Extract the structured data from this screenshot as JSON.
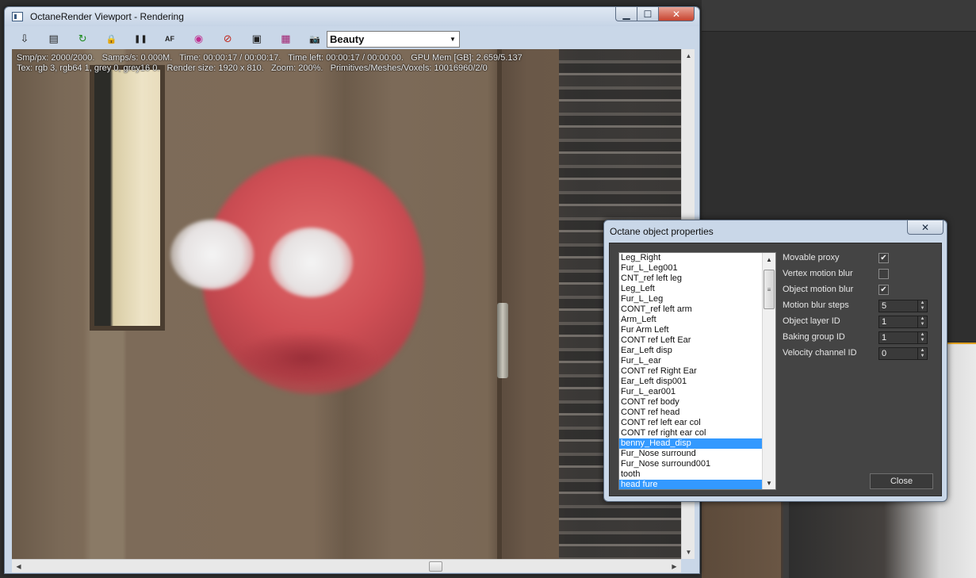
{
  "viewport": {
    "title": "OctaneRender Viewport - Rendering",
    "window_buttons": {
      "minimize": "▁",
      "maximize": "☐",
      "close": "✕"
    },
    "toolbar": {
      "icons": [
        "export-icon",
        "clipboard-icon",
        "refresh-icon",
        "lock-icon",
        "pause-icon",
        "af-icon",
        "color-wheel-icon",
        "region-icon",
        "monitor-icon",
        "film-icon",
        "camera-icon"
      ],
      "icon_glyphs": [
        "⇩",
        "▤",
        "↻",
        "🔒",
        "❚❚",
        "AF",
        "◉",
        "⊘",
        "▣",
        "▦",
        "📷"
      ],
      "render_pass": "Beauty"
    },
    "stats_line1": "Smp/px: 2000/2000.   Samps/s: 0.000M.   Time: 00:00:17 / 00:00:17.   Time left: 00:00:17 / 00:00:00.   GPU Mem [GB]: 2.659/5.137",
    "stats_line2": "Tex: rgb 3, rgb64 1, grey 0, grey16 0.   Render size: 1920 x 810.   Zoom: 200%.   Primitives/Meshes/Voxels: 10016960/2/0"
  },
  "dialog": {
    "title": "Octane object properties",
    "close_x": "✕",
    "objects": [
      {
        "label": "Leg_Right",
        "selected": false
      },
      {
        "label": "Fur_L_Leg001",
        "selected": false
      },
      {
        "label": "CNT_ref left leg",
        "selected": false
      },
      {
        "label": "Leg_Left",
        "selected": false
      },
      {
        "label": "Fur_L_Leg",
        "selected": false
      },
      {
        "label": "CONT_ref left arm",
        "selected": false
      },
      {
        "label": "Arm_Left",
        "selected": false
      },
      {
        "label": "Fur Arm Left",
        "selected": false
      },
      {
        "label": "CONT ref Left Ear",
        "selected": false
      },
      {
        "label": "Ear_Left disp",
        "selected": false
      },
      {
        "label": "Fur_L_ear",
        "selected": false
      },
      {
        "label": "CONT ref Right Ear",
        "selected": false
      },
      {
        "label": "Ear_Left disp001",
        "selected": false
      },
      {
        "label": "Fur_L_ear001",
        "selected": false
      },
      {
        "label": "CONT ref body",
        "selected": false
      },
      {
        "label": "CONT ref head",
        "selected": false
      },
      {
        "label": "CONT ref left ear col",
        "selected": false
      },
      {
        "label": "CONT ref right ear col",
        "selected": false
      },
      {
        "label": "benny_Head_disp",
        "selected": true
      },
      {
        "label": "Fur_Nose surround",
        "selected": false
      },
      {
        "label": "Fur_Nose surround001",
        "selected": false
      },
      {
        "label": "tooth",
        "selected": false
      },
      {
        "label": "head fure",
        "selected": true
      }
    ],
    "properties": {
      "movable_proxy": {
        "label": "Movable proxy",
        "checked": true
      },
      "vertex_motion_blur": {
        "label": "Vertex motion blur",
        "checked": false
      },
      "object_motion_blur": {
        "label": "Object motion blur",
        "checked": true
      },
      "motion_blur_steps": {
        "label": "Motion blur steps",
        "value": "5"
      },
      "object_layer_id": {
        "label": "Object layer ID",
        "value": "1"
      },
      "baking_group_id": {
        "label": "Baking group ID",
        "value": "1"
      },
      "velocity_channel_id": {
        "label": "Velocity channel ID",
        "value": "0"
      }
    },
    "close_label": "Close"
  },
  "glyphs": {
    "check": "✔",
    "spin": "▲▼",
    "up": "▲",
    "down": "▼",
    "left": "◀",
    "right": "▶",
    "dropdown": "▼",
    "grip": "≡"
  },
  "colors": {
    "selection": "#3399ff",
    "panel": "#444444",
    "titlebar": "#c9d7e8"
  }
}
